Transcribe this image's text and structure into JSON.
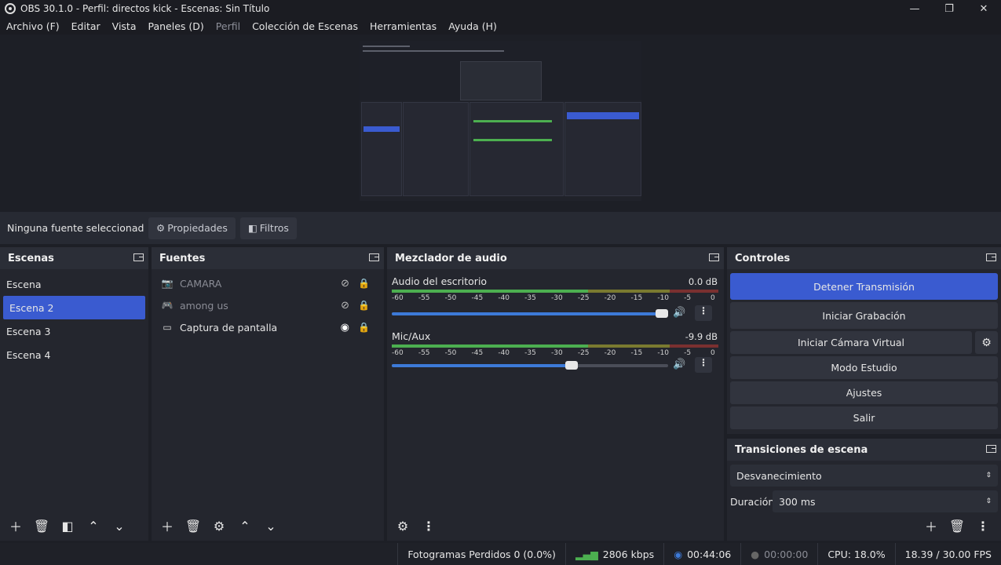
{
  "window": {
    "title": "OBS 30.1.0 - Perfil: directos kick - Escenas: Sin Título",
    "minimize": "—",
    "maximize": "❐",
    "close": "✕"
  },
  "menu": [
    "Archivo (F)",
    "Editar",
    "Vista",
    "Paneles (D)",
    "Perfil",
    "Colección de Escenas",
    "Herramientas",
    "Ayuda (H)"
  ],
  "source_bar": {
    "no_selection": "Ninguna fuente seleccionad",
    "properties": "Propiedades",
    "filters": "Filtros"
  },
  "scenes": {
    "title": "Escenas",
    "items": [
      "Escena",
      "Escena 2",
      "Escena 3",
      "Escena 4"
    ],
    "selected_index": 1
  },
  "sources": {
    "title": "Fuentes",
    "items": [
      {
        "name": "CAMARA",
        "icon": "camera-icon",
        "visible": false
      },
      {
        "name": "among us",
        "icon": "gamepad-icon",
        "visible": false
      },
      {
        "name": "Captura de pantalla",
        "icon": "monitor-icon",
        "visible": true
      }
    ]
  },
  "mixer": {
    "title": "Mezclador de audio",
    "channels": [
      {
        "name": "Audio del escritorio",
        "db": "0.0 dB",
        "volume": 1.0
      },
      {
        "name": "Mic/Aux",
        "db": "-9.9 dB",
        "volume": 0.65
      }
    ],
    "ticks": [
      "-60",
      "-55",
      "-50",
      "-45",
      "-40",
      "-35",
      "-30",
      "-25",
      "-20",
      "-15",
      "-10",
      "-5",
      "0"
    ]
  },
  "controls": {
    "title": "Controles",
    "stop_stream": "Detener Transmisión",
    "start_recording": "Iniciar Grabación",
    "start_virtual_cam": "Iniciar Cámara Virtual",
    "studio_mode": "Modo Estudio",
    "settings": "Ajustes",
    "exit": "Salir"
  },
  "transitions": {
    "title": "Transiciones de escena",
    "selected": "Desvanecimiento",
    "duration_label": "Duración",
    "duration_value": "300 ms"
  },
  "status": {
    "dropped": "Fotogramas Perdidos 0 (0.0%)",
    "bitrate": "2806 kbps",
    "stream_time": "00:44:06",
    "rec_time": "00:00:00",
    "cpu": "CPU: 18.0%",
    "fps": "18.39 / 30.00 FPS"
  },
  "colors": {
    "accent": "#3a5bd0",
    "meter_green": "#4caf50",
    "slider_blue": "#3d7ad8"
  }
}
